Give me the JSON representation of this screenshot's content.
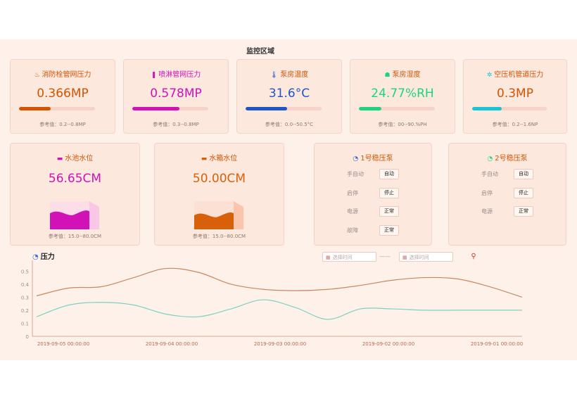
{
  "section_title": "监控区域",
  "gauges": [
    {
      "title": "消防栓管网压力",
      "icon": "fire-hydrant-icon",
      "glyph": "♨",
      "value": "0.366MP",
      "color": "#d35400",
      "fill": 0.42,
      "ref": "参考值：0.2--0.8MP"
    },
    {
      "title": "喷淋管网压力",
      "icon": "sprinkler-icon",
      "glyph": "❚",
      "value": "0.578MP",
      "color": "#d112b6",
      "fill": 0.62,
      "ref": "参考值：0.3--0.8MP"
    },
    {
      "title": "泵房温度",
      "icon": "thermometer-icon",
      "glyph": "🌡",
      "value": "31.6°C",
      "color": "#1f55c7",
      "fill": 0.55,
      "ref": "参考值：0.0--50.5°C"
    },
    {
      "title": "泵房湿度",
      "icon": "humidity-icon",
      "glyph": "☗",
      "value": "24.77%RH",
      "color": "#1ed47f",
      "fill": 0.3,
      "ref": "参考值：00--90.%PH"
    },
    {
      "title": "空压机管道压力",
      "icon": "compressor-icon",
      "glyph": "✲",
      "value": "0.3MP",
      "color": "#18c5d6",
      "fill": 0.4,
      "ref": "参考值：0.2--1.6NP"
    }
  ],
  "tanks": [
    {
      "title": "水池水位",
      "icon": "pool-icon",
      "value": "56.65CM",
      "color": "#d112b6",
      "level": 0.57,
      "ref": "参考值：15.0--80.0CM"
    },
    {
      "title": "水箱水位",
      "icon": "water-tank-icon",
      "value": "50.00CM",
      "color": "#d8600a",
      "level": 0.5,
      "ref": "参考值：15.0--80.0CM"
    }
  ],
  "pumps": [
    {
      "title": "1号稳压泵",
      "rows": [
        {
          "label": "手自动",
          "status": "自动"
        },
        {
          "label": "启停",
          "status": "停止"
        },
        {
          "label": "电源",
          "status": "正常"
        },
        {
          "label": "故障",
          "status": "正常"
        }
      ]
    },
    {
      "title": "2号稳压泵",
      "rows": [
        {
          "label": "手自动",
          "status": "自动"
        },
        {
          "label": "启停",
          "status": "停止"
        },
        {
          "label": "电源",
          "status": "正常"
        }
      ]
    }
  ],
  "chart": {
    "title": "压力",
    "date_placeholder_start": "选择时间",
    "date_placeholder_end": "选择时间",
    "separator": "——"
  },
  "chart_data": {
    "type": "line",
    "title": "压力",
    "ylim": [
      0,
      0.55
    ],
    "y_ticks": [
      "0",
      "0.1",
      "0.2",
      "0.3",
      "0.4",
      "0.5"
    ],
    "x_tick_labels": [
      "2019-09-05 00:00:00",
      "2019-09-04 00:00:00",
      "2019-09-03 00:00:00",
      "2019-09-02 00:00:00",
      "2019-09-01 00:00:00"
    ],
    "series": [
      {
        "color": "#c9875f",
        "values": [
          0.31,
          0.37,
          0.38,
          0.45,
          0.52,
          0.49,
          0.4,
          0.36,
          0.35,
          0.36,
          0.39,
          0.43,
          0.45,
          0.44,
          0.38,
          0.3
        ]
      },
      {
        "color": "#7fd1c1",
        "values": [
          0.15,
          0.24,
          0.26,
          0.24,
          0.17,
          0.15,
          0.21,
          0.28,
          0.22,
          0.13,
          0.21,
          0.21,
          0.2,
          0.2,
          0.2,
          0.2
        ]
      }
    ],
    "grid": false,
    "legend": "none"
  }
}
